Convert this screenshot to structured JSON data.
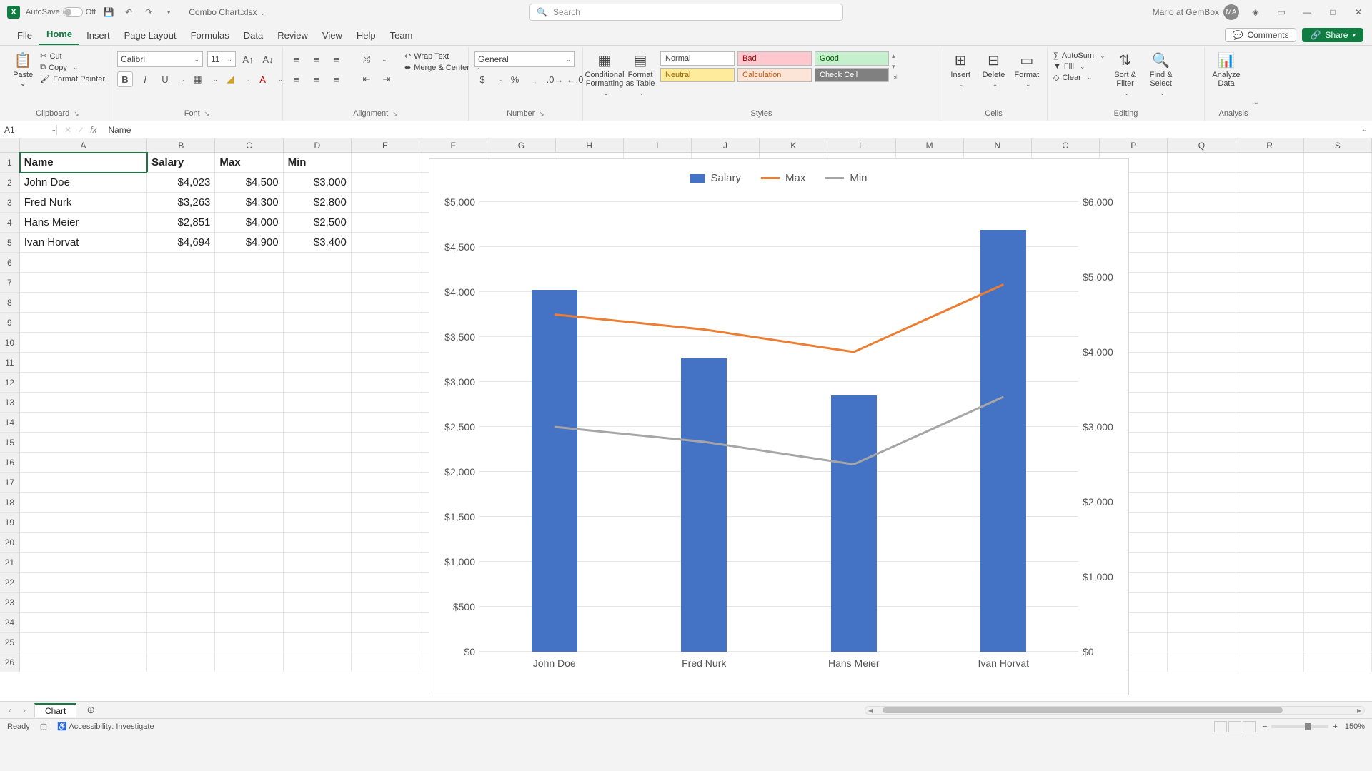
{
  "title_bar": {
    "autosave_label": "AutoSave",
    "autosave_state": "Off",
    "filename": "Combo Chart.xlsx",
    "search_placeholder": "Search",
    "user_name": "Mario at GemBox",
    "user_initials": "MA"
  },
  "tabs": {
    "items": [
      "File",
      "Home",
      "Insert",
      "Page Layout",
      "Formulas",
      "Data",
      "Review",
      "View",
      "Help",
      "Team"
    ],
    "active": "Home",
    "comments": "Comments",
    "share": "Share"
  },
  "ribbon": {
    "clipboard": {
      "paste": "Paste",
      "cut": "Cut",
      "copy": "Copy",
      "painter": "Format Painter",
      "group": "Clipboard"
    },
    "font": {
      "name": "Calibri",
      "size": "11",
      "group": "Font"
    },
    "alignment": {
      "wrap": "Wrap Text",
      "merge": "Merge & Center",
      "group": "Alignment"
    },
    "number": {
      "format": "General",
      "group": "Number"
    },
    "styles": {
      "cond": "Conditional Formatting",
      "table": "Format as Table",
      "cells": [
        "Normal",
        "Bad",
        "Good",
        "Neutral",
        "Calculation",
        "Check Cell"
      ],
      "group": "Styles"
    },
    "cells_grp": {
      "insert": "Insert",
      "delete": "Delete",
      "format": "Format",
      "group": "Cells"
    },
    "editing": {
      "autosum": "AutoSum",
      "fill": "Fill",
      "clear": "Clear",
      "sort": "Sort & Filter",
      "find": "Find & Select",
      "group": "Editing"
    },
    "analysis": {
      "analyze": "Analyze Data",
      "group": "Analysis"
    }
  },
  "formula_bar": {
    "name_box": "A1",
    "formula": "Name"
  },
  "grid": {
    "columns": [
      "A",
      "B",
      "C",
      "D",
      "E",
      "F",
      "G",
      "H",
      "I",
      "J",
      "K",
      "L",
      "M",
      "N",
      "O",
      "P",
      "Q",
      "R",
      "S"
    ],
    "rows_shown": 26,
    "headers": {
      "A": "Name",
      "B": "Salary",
      "C": "Max",
      "D": "Min"
    },
    "data_rows": [
      {
        "n": "2",
        "A": "John Doe",
        "B": "$4,023",
        "C": "$4,500",
        "D": "$3,000"
      },
      {
        "n": "3",
        "A": "Fred Nurk",
        "B": "$3,263",
        "C": "$4,300",
        "D": "$2,800"
      },
      {
        "n": "4",
        "A": "Hans Meier",
        "B": "$2,851",
        "C": "$4,000",
        "D": "$2,500"
      },
      {
        "n": "5",
        "A": "Ivan Horvat",
        "B": "$4,694",
        "C": "$4,900",
        "D": "$3,400"
      }
    ]
  },
  "chart_data": {
    "type": "combo",
    "categories": [
      "John Doe",
      "Fred Nurk",
      "Hans Meier",
      "Ivan Horvat"
    ],
    "series": [
      {
        "name": "Salary",
        "type": "bar",
        "axis": "left",
        "color": "#4472c4",
        "values": [
          4023,
          3263,
          2851,
          4694
        ]
      },
      {
        "name": "Max",
        "type": "line",
        "axis": "right",
        "color": "#ed7d31",
        "values": [
          4500,
          4300,
          4000,
          4900
        ]
      },
      {
        "name": "Min",
        "type": "line",
        "axis": "right",
        "color": "#a6a6a6",
        "values": [
          3000,
          2800,
          2500,
          3400
        ]
      }
    ],
    "y_left": {
      "min": 0,
      "max": 5000,
      "step": 500,
      "format": "$#,##0",
      "ticks": [
        "$0",
        "$500",
        "$1,000",
        "$1,500",
        "$2,000",
        "$2,500",
        "$3,000",
        "$3,500",
        "$4,000",
        "$4,500",
        "$5,000"
      ]
    },
    "y_right": {
      "min": 0,
      "max": 6000,
      "step": 1000,
      "format": "$#,##0",
      "ticks": [
        "$0",
        "$1,000",
        "$2,000",
        "$3,000",
        "$4,000",
        "$5,000",
        "$6,000"
      ]
    },
    "xlabel": "",
    "ylabel": "",
    "title": ""
  },
  "sheet_bar": {
    "active_sheet": "Chart"
  },
  "status": {
    "ready": "Ready",
    "accessibility": "Accessibility: Investigate",
    "zoom": "150%"
  }
}
